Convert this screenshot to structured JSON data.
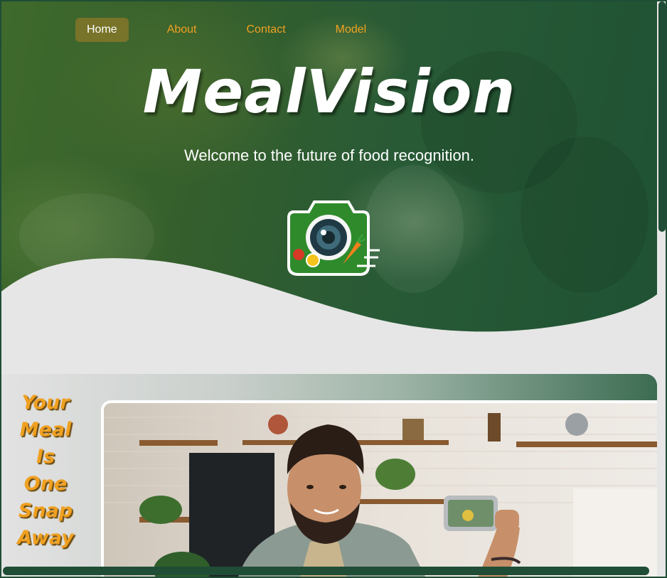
{
  "nav": {
    "items": [
      {
        "label": "Home",
        "active": true
      },
      {
        "label": "About",
        "active": false
      },
      {
        "label": "Contact",
        "active": false
      },
      {
        "label": "Model",
        "active": false
      }
    ]
  },
  "hero": {
    "brand": "MealVision",
    "tagline": "Welcome to the future of food recognition.",
    "logo_icon": "camera-food-logo-icon"
  },
  "section": {
    "side_text": [
      "Your",
      "Meal",
      "Is",
      "One",
      "Snap",
      "Away"
    ],
    "photo": "man-taking-food-selfie-in-kitchen"
  },
  "colors": {
    "accent": "#f0a020",
    "dark_green": "#1f4d36",
    "background": "#e6e6e6"
  }
}
